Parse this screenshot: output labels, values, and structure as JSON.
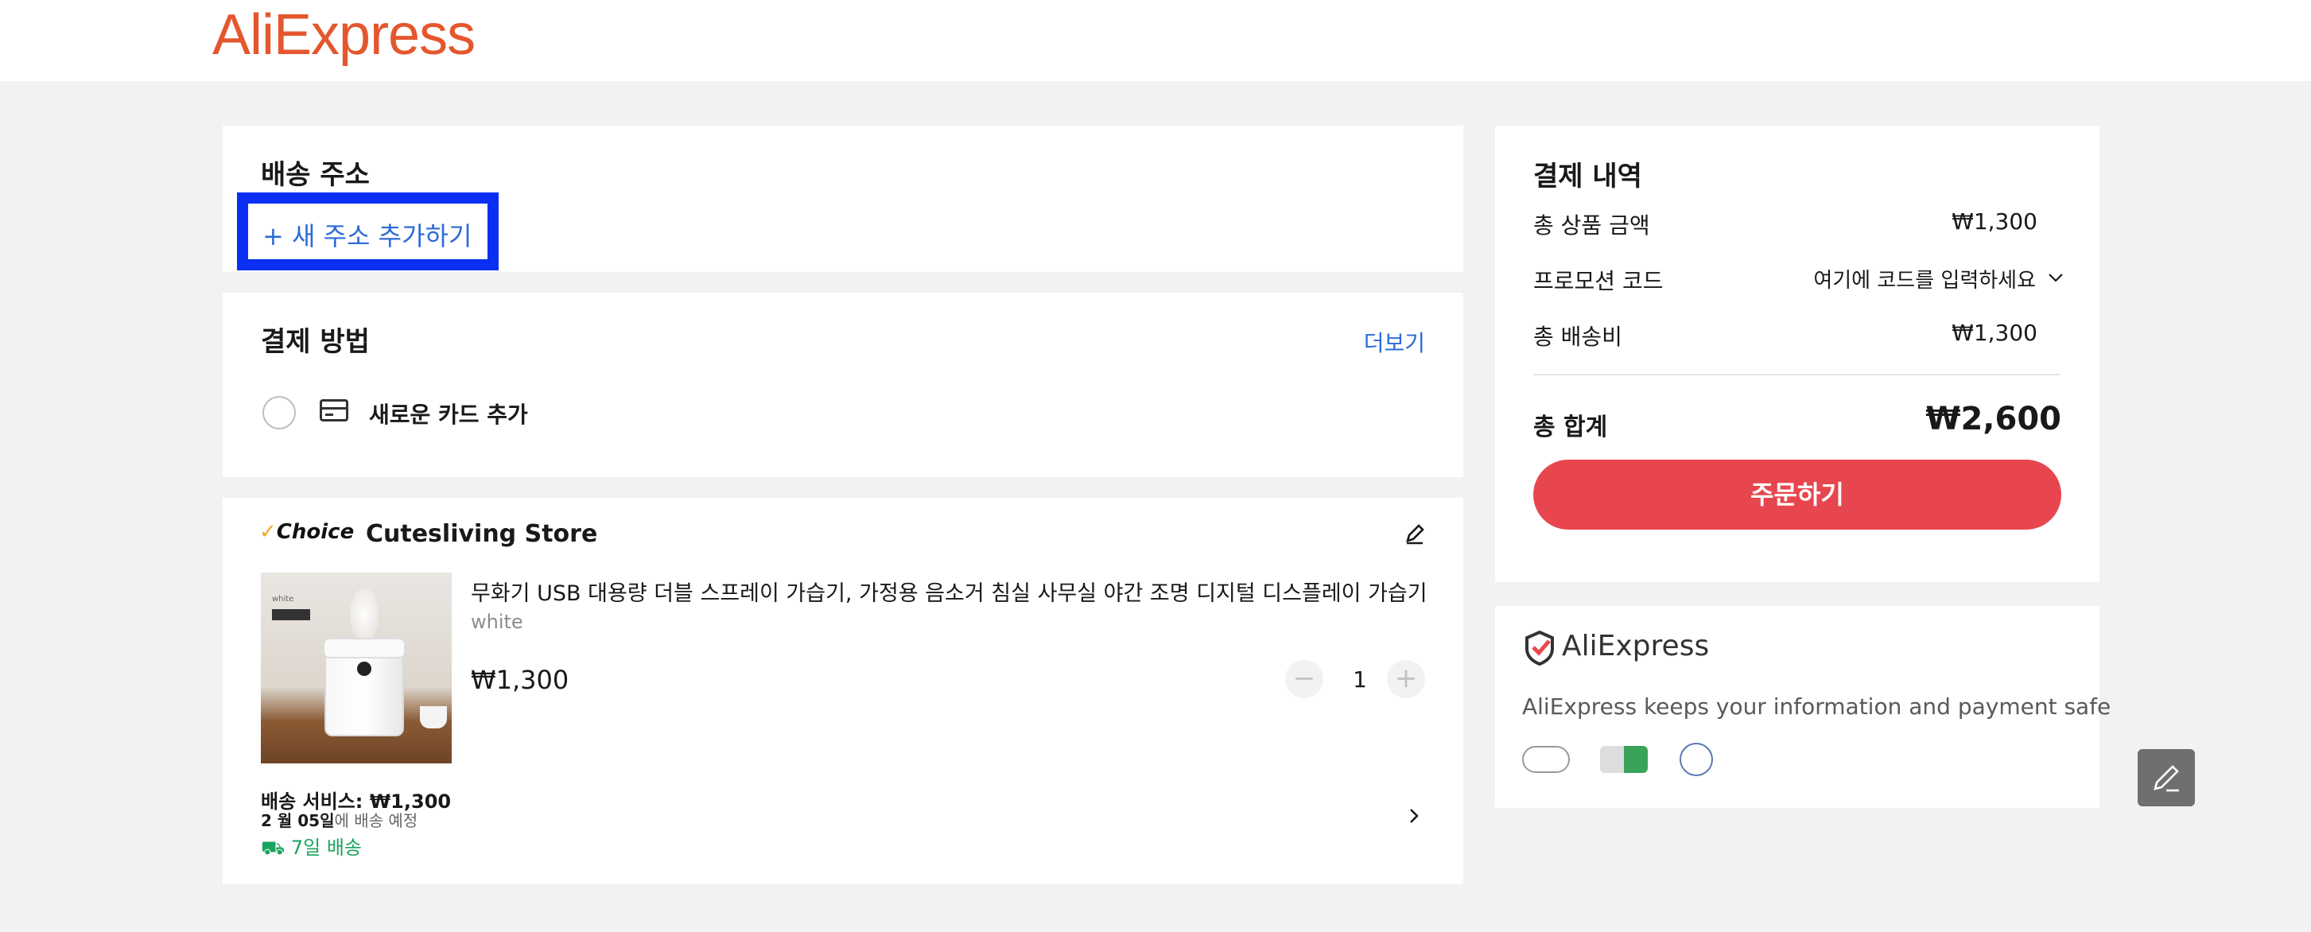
{
  "header": {
    "logo": "AliExpress"
  },
  "address": {
    "title": "배송 주소",
    "add_button": "+ 새 주소 추가하기"
  },
  "payment": {
    "title": "결제 방법",
    "more": "더보기",
    "new_card": "새로운 카드 추가"
  },
  "store": {
    "badge": "Choice",
    "name": "Cutesliving Store",
    "product": {
      "title": "무화기 USB 대용량 더블 스프레이 가습기, 가정용 음소거 침실 사무실 야간 조명 디지털 디스플레이 가습기, ...",
      "variant": "white",
      "price": "₩1,300",
      "quantity": "1",
      "thumb_tag": "white"
    },
    "shipping_service": "배송 서비스: ₩1,300",
    "eta_date": "2 월 05일",
    "eta_suffix": "에 배송 예정",
    "delivery": "7일 배송"
  },
  "summary": {
    "title": "결제 내역",
    "subtotal_label": "총 상품 금액",
    "subtotal": "₩1,300",
    "promo_label": "프로모션 코드",
    "promo_placeholder": "여기에 코드를 입력하세요",
    "shipping_label": "총 배송비",
    "shipping": "₩1,300",
    "total_label": "총 합계",
    "total": "₩2,600",
    "order_button": "주문하기"
  },
  "safety": {
    "logo": "AliExpress",
    "text": "AliExpress keeps your information and payment safe"
  },
  "colors": {
    "brand": "#e4572e",
    "order_button": "#e8464f",
    "link": "#2b6bd8",
    "highlight": "#0a2ff2",
    "delivery": "#1aa35e"
  }
}
